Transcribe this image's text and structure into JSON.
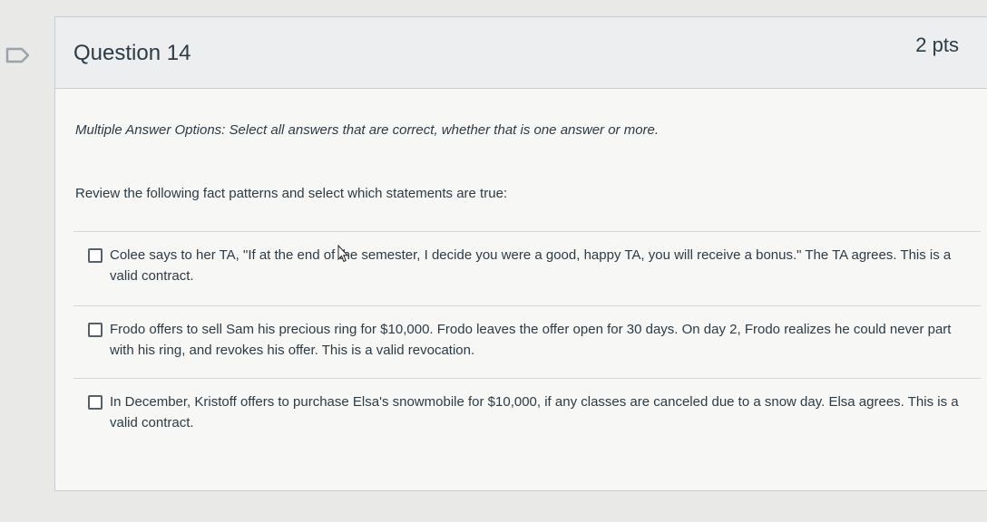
{
  "question": {
    "title": "Question 14",
    "points": "2 pts",
    "instructions": "Multiple Answer Options: Select all answers that are correct, whether that is one answer or more.",
    "prompt": "Review the following fact patterns and select which statements are true:"
  },
  "answers": [
    {
      "text": "Colee says to her TA, \"If at the end of the semester, I decide you were a good, happy TA, you will receive a bonus.\" The TA agrees. This is a valid contract.",
      "checked": false
    },
    {
      "text": "Frodo offers to sell Sam his precious ring for $10,000. Frodo leaves the offer open for 30 days. On day 2, Frodo realizes he could never part with his ring, and revokes his offer. This is a valid revocation.",
      "checked": false
    },
    {
      "text": "In December, Kristoff offers to purchase Elsa's snowmobile for $10,000, if any classes are canceled due to a snow day. Elsa agrees. This is a valid contract.",
      "checked": false
    }
  ],
  "icons": {
    "bookmark": "bookmark-outline-icon",
    "cursor": "mouse-pointer-icon"
  }
}
